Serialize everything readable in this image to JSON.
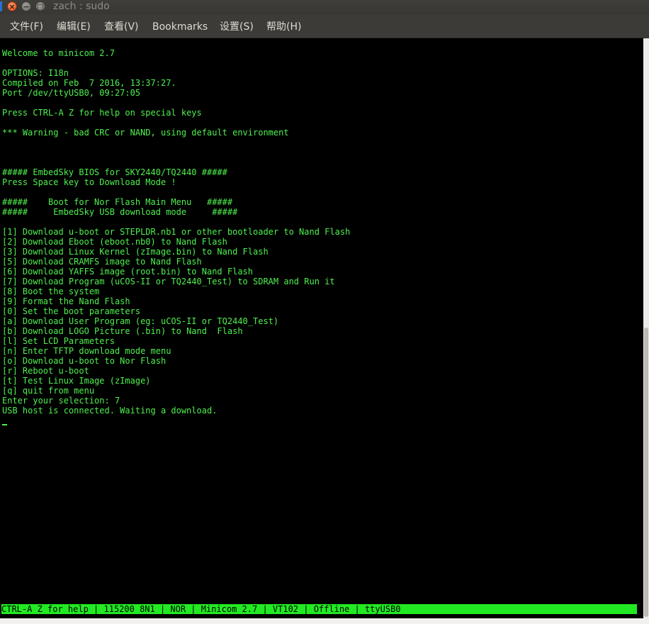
{
  "window": {
    "title": "zach : sudo",
    "close_glyph": "×",
    "min_glyph": "−",
    "max_glyph": "□"
  },
  "menu": [
    {
      "label": "文件(F)"
    },
    {
      "label": "编辑(E)"
    },
    {
      "label": "查看(V)"
    },
    {
      "label": "Bookmarks"
    },
    {
      "label": "设置(S)"
    },
    {
      "label": "帮助(H)"
    }
  ],
  "terminal": {
    "text_color": "#4ef04e",
    "background": "#000000",
    "lines": [
      "Welcome to minicom 2.7",
      "",
      "OPTIONS: I18n",
      "Compiled on Feb  7 2016, 13:37:27.",
      "Port /dev/ttyUSB0, 09:27:05",
      "",
      "Press CTRL-A Z for help on special keys",
      "",
      "*** Warning - bad CRC or NAND, using default environment",
      "",
      "",
      "",
      "##### EmbedSky BIOS for SKY2440/TQ2440 #####",
      "Press Space key to Download Mode !",
      "",
      "#####    Boot for Nor Flash Main Menu   #####",
      "#####     EmbedSky USB download mode     #####",
      "",
      "[1] Download u-boot or STEPLDR.nb1 or other bootloader to Nand Flash",
      "[2] Download Eboot (eboot.nb0) to Nand Flash",
      "[3] Download Linux Kernel (zImage.bin) to Nand Flash",
      "[5] Download CRAMFS image to Nand Flash",
      "[6] Download YAFFS image (root.bin) to Nand Flash",
      "[7] Download Program (uCOS-II or TQ2440_Test) to SDRAM and Run it",
      "[8] Boot the system",
      "[9] Format the Nand Flash",
      "[0] Set the boot parameters",
      "[a] Download User Program (eg: uCOS-II or TQ2440_Test)",
      "[b] Download LOGO Picture (.bin) to Nand  Flash",
      "[l] Set LCD Parameters",
      "[n] Enter TFTP download mode menu",
      "[o] Download u-boot to Nor Flash",
      "[r] Reboot u-boot",
      "[t] Test Linux Image (zImage)",
      "[q] quit from menu",
      "Enter your selection: 7",
      "USB host is connected. Waiting a download."
    ]
  },
  "status_bar": {
    "text": "CTRL-A Z for help | 115200 8N1 | NOR | Minicom 2.7 | VT102 | Offline | ttyUSB0",
    "background": "#22ea22"
  }
}
